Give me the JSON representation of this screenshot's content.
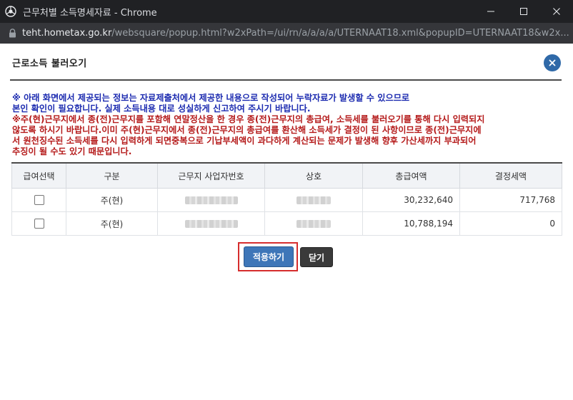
{
  "window": {
    "title": "근무처별 소득명세자료 - Chrome",
    "url_host": "teht.hometax.go.kr",
    "url_path": "/websquare/popup.html?w2xPath=/ui/rn/a/a/a/a/UTERNAAT18.xml&popupID=UTERNAAT18&w2x..."
  },
  "dialog": {
    "title": "근로소득 불러오기",
    "notice_blue": "※ 아래 화면에서 제공되는 정보는 자료제출처에서 제공한 내용으로 작성되어 누락자료가 발생할 수 있으므로\n본인 확인이 필요합니다. 실제 소득내용 대로 성실하게 신고하여 주시기 바랍니다.",
    "notice_red": "※주(현)근무지에서 종(전)근무지를 포함해 연말정산을 한 경우 종(전)근무지의 총급여, 소득세를 불러오기를 통해 다시 입력되지\n않도록 하시기 바랍니다.이미 주(현)근무지에서 종(전)근무지의 총급여를 환산해 소득세가 결정이 된 사항이므로 종(전)근무지에\n서 원천징수된 소득세를 다시 입력하게 되면중복으로 기납부세액이 과다하게 계산되는 문제가 발생해 향후 가산세까지 부과되어\n추징이 될 수도 있기 때문입니다."
  },
  "table": {
    "headers": [
      "급여선택",
      "구분",
      "근무지 사업자번호",
      "상호",
      "총급여액",
      "결정세액"
    ],
    "rows": [
      {
        "type": "주(현)",
        "total_pay": "30,232,640",
        "tax": "717,768"
      },
      {
        "type": "주(현)",
        "total_pay": "10,788,194",
        "tax": "0"
      }
    ]
  },
  "buttons": {
    "apply": "적용하기",
    "close": "닫기"
  }
}
